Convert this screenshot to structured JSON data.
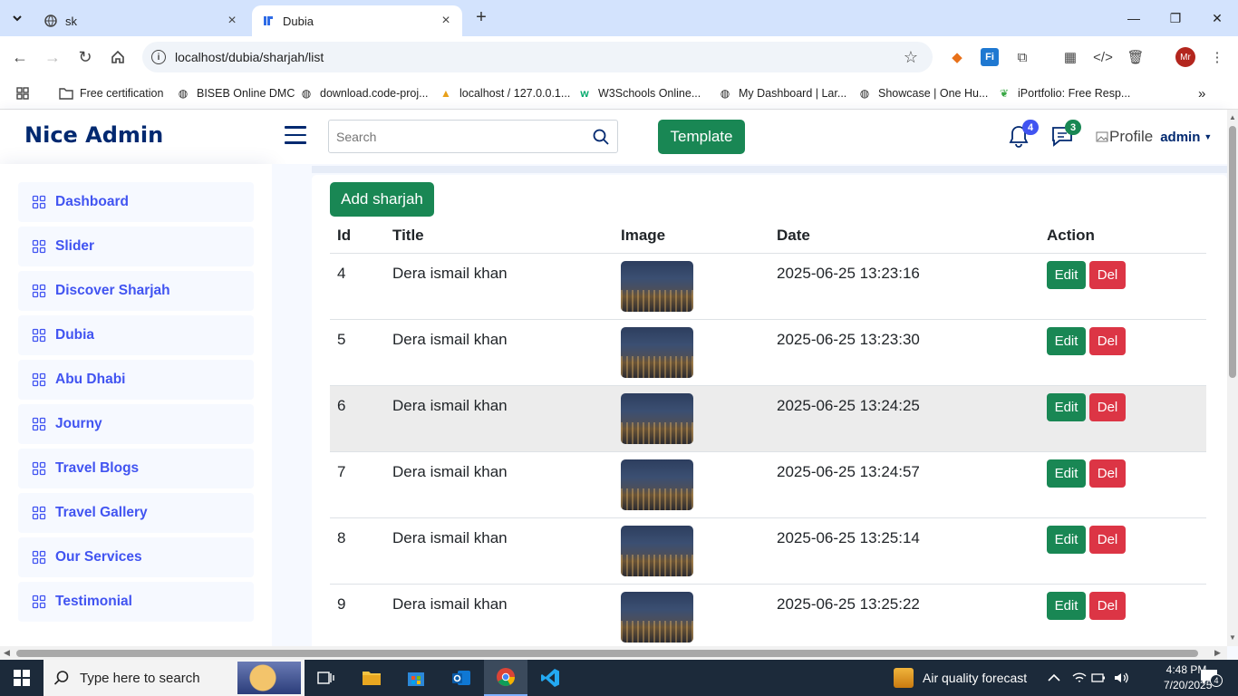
{
  "browser": {
    "tabs": [
      {
        "title": "sk",
        "active": false
      },
      {
        "title": "Dubia",
        "active": true
      }
    ],
    "url": "localhost/dubia/sharjah/list",
    "bookmarks": [
      "Free certification",
      "BISEB Online DMC",
      "download.code-proj...",
      "localhost / 127.0.0.1...",
      "W3Schools Online...",
      "My Dashboard | Lar...",
      "Showcase | One Hu...",
      "iPortfolio: Free Resp..."
    ],
    "profile_initials": "Mr"
  },
  "header": {
    "logo": "Nice Admin",
    "search_placeholder": "Search",
    "template_button": "Template",
    "notifications_count": "4",
    "messages_count": "3",
    "profile_alt": "Profile",
    "profile_name": "admin"
  },
  "sidebar": {
    "items": [
      {
        "label": "Dashboard"
      },
      {
        "label": "Slider"
      },
      {
        "label": "Discover Sharjah"
      },
      {
        "label": "Dubia"
      },
      {
        "label": "Abu Dhabi"
      },
      {
        "label": "Journy"
      },
      {
        "label": "Travel Blogs"
      },
      {
        "label": "Travel Gallery"
      },
      {
        "label": "Our Services"
      },
      {
        "label": "Testimonial"
      }
    ]
  },
  "main": {
    "add_button": "Add sharjah",
    "columns": [
      "Id",
      "Title",
      "Image",
      "Date",
      "Action"
    ],
    "rows": [
      {
        "id": "4",
        "title": "Dera ismail khan",
        "date": "2025-06-25 13:23:16"
      },
      {
        "id": "5",
        "title": "Dera ismail khan",
        "date": "2025-06-25 13:23:30"
      },
      {
        "id": "6",
        "title": "Dera ismail khan",
        "date": "2025-06-25 13:24:25"
      },
      {
        "id": "7",
        "title": "Dera ismail khan",
        "date": "2025-06-25 13:24:57"
      },
      {
        "id": "8",
        "title": "Dera ismail khan",
        "date": "2025-06-25 13:25:14"
      },
      {
        "id": "9",
        "title": "Dera ismail khan",
        "date": "2025-06-25 13:25:22"
      }
    ],
    "edit_label": "Edit",
    "delete_label": "Del"
  },
  "taskbar": {
    "search_placeholder": "Type here to search",
    "weather": "Air quality forecast",
    "time": "4:48 PM",
    "date": "7/20/2025",
    "notification_count": "4"
  },
  "colors": {
    "brand": "#012970",
    "nav_link": "#4154f1",
    "success": "#198754",
    "danger": "#dc3545"
  }
}
